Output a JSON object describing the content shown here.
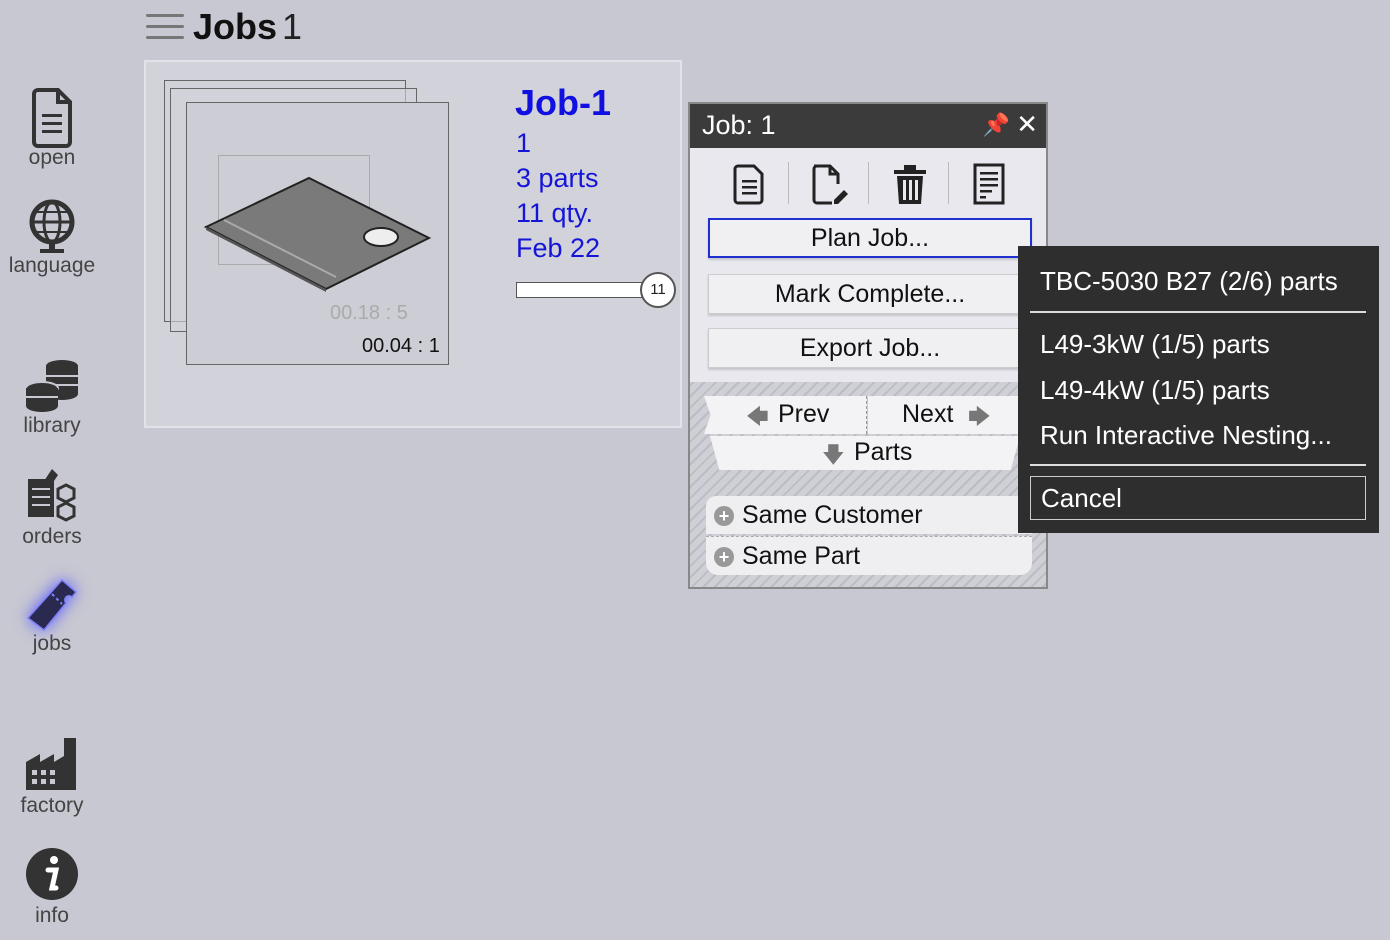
{
  "header": {
    "title": "Jobs",
    "count": "1"
  },
  "sidebar": {
    "items": [
      {
        "label": "open",
        "icon": "document-icon"
      },
      {
        "label": "language",
        "icon": "globe-icon"
      },
      {
        "label": "library",
        "icon": "database-icon"
      },
      {
        "label": "orders",
        "icon": "orders-icon"
      },
      {
        "label": "jobs",
        "icon": "ticket-icon"
      },
      {
        "label": "factory",
        "icon": "factory-icon"
      },
      {
        "label": "info",
        "icon": "info-icon"
      }
    ],
    "active": "jobs"
  },
  "job_card": {
    "name": "Job-1",
    "id": "1",
    "parts": "3 parts",
    "qty": "11 qty.",
    "date": "Feb 22",
    "time_back": "00.18 : 5",
    "time_front": "00.04 : 1",
    "progress_value": "11"
  },
  "panel": {
    "title": "Job: 1",
    "toolbar": [
      "document-icon",
      "edit-document-icon",
      "trash-icon",
      "report-icon"
    ],
    "plan_job": "Plan Job...",
    "mark_complete": "Mark Complete...",
    "export_job": "Export Job...",
    "prev": "Prev",
    "next": "Next",
    "parts": "Parts",
    "same_customer": "Same Customer",
    "same_part": "Same Part"
  },
  "menu": {
    "items": [
      "TBC-5030 B27  (2/6) parts",
      "L49-3kW  (1/5) parts",
      "L49-4kW  (1/5) parts",
      "Run Interactive Nesting..."
    ],
    "cancel": "Cancel"
  },
  "colors": {
    "accent": "#1515d8",
    "background": "#c8c8d2",
    "menu_bg": "#2e2e2e",
    "focus": "#2030d0"
  }
}
